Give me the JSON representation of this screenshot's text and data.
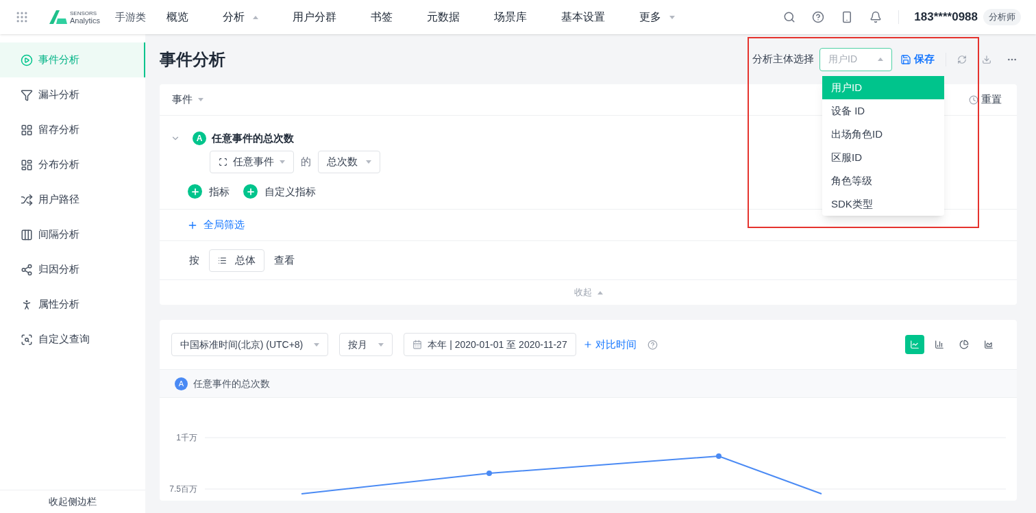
{
  "topbar": {
    "logo_line1": "SENSORS",
    "logo_line2": "Analytics",
    "project": "手游类",
    "nav": [
      {
        "label": "概览",
        "dropdown": false
      },
      {
        "label": "分析",
        "dropdown": true
      },
      {
        "label": "用户分群",
        "dropdown": false
      },
      {
        "label": "书签",
        "dropdown": false
      },
      {
        "label": "元数据",
        "dropdown": false
      },
      {
        "label": "场景库",
        "dropdown": false
      },
      {
        "label": "基本设置",
        "dropdown": false
      },
      {
        "label": "更多",
        "dropdown": true
      }
    ],
    "user": "183****0988",
    "role": "分析师"
  },
  "sidebar": {
    "items": [
      {
        "label": "事件分析",
        "selected": true
      },
      {
        "label": "漏斗分析",
        "selected": false
      },
      {
        "label": "留存分析",
        "selected": false
      },
      {
        "label": "分布分析",
        "selected": false
      },
      {
        "label": "用户路径",
        "selected": false
      },
      {
        "label": "间隔分析",
        "selected": false
      },
      {
        "label": "归因分析",
        "selected": false
      },
      {
        "label": "属性分析",
        "selected": false
      },
      {
        "label": "自定义查询",
        "selected": false
      }
    ],
    "collapse": "收起侧边栏"
  },
  "page": {
    "title": "事件分析",
    "subject_label": "分析主体选择",
    "subject_value": "用户ID",
    "save": "保存",
    "subject_options": [
      {
        "label": "用户ID",
        "selected": true
      },
      {
        "label": "设备 ID",
        "selected": false
      },
      {
        "label": "出场角色ID",
        "selected": false
      },
      {
        "label": "区服ID",
        "selected": false
      },
      {
        "label": "角色等级",
        "selected": false
      },
      {
        "label": "SDK类型",
        "selected": false
      }
    ]
  },
  "query": {
    "section": "事件",
    "reset": "重置",
    "metric_badge": "A",
    "metric_title": "任意事件的总次数",
    "event_select": "任意事件",
    "of": "的",
    "agg_select": "总次数",
    "add_metric": "指标",
    "add_custom": "自定义指标",
    "global_filter": "全局筛选",
    "by": "按",
    "group_select": "总体",
    "view": "查看",
    "collapse": "收起"
  },
  "result": {
    "timezone": "中国标准时间(北京) (UTC+8)",
    "granularity": "按月",
    "date_range": "本年 | 2020-01-01 至 2020-11-27",
    "compare": "对比时间",
    "chart_types": [
      {
        "kind": "line",
        "selected": true
      },
      {
        "kind": "bar",
        "selected": false
      },
      {
        "kind": "pie",
        "selected": false
      },
      {
        "kind": "area",
        "selected": false
      }
    ],
    "legend_badge": "A",
    "legend": "任意事件的总次数",
    "chart": {
      "y_labels": [
        "1千万",
        "7.5百万"
      ]
    }
  }
}
